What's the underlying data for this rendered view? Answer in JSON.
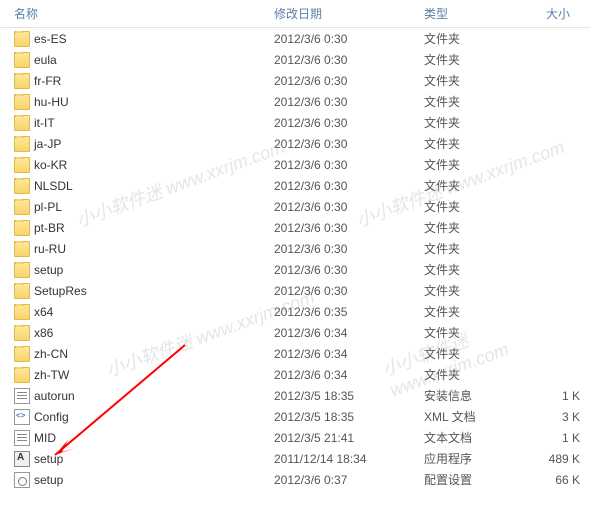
{
  "header": {
    "name": "名称",
    "date": "修改日期",
    "type": "类型",
    "size": "大小"
  },
  "iconTypes": {
    "folder": "folder-icon",
    "ini": "ini-icon",
    "xml": "xml-icon",
    "txt": "txt-icon",
    "exe": "exe-icon",
    "cfg": "cfg-icon"
  },
  "rows": [
    {
      "name": "es-ES",
      "date": "2012/3/6 0:30",
      "type": "文件夹",
      "size": "",
      "icon": "folder"
    },
    {
      "name": "eula",
      "date": "2012/3/6 0:30",
      "type": "文件夹",
      "size": "",
      "icon": "folder"
    },
    {
      "name": "fr-FR",
      "date": "2012/3/6 0:30",
      "type": "文件夹",
      "size": "",
      "icon": "folder"
    },
    {
      "name": "hu-HU",
      "date": "2012/3/6 0:30",
      "type": "文件夹",
      "size": "",
      "icon": "folder"
    },
    {
      "name": "it-IT",
      "date": "2012/3/6 0:30",
      "type": "文件夹",
      "size": "",
      "icon": "folder"
    },
    {
      "name": "ja-JP",
      "date": "2012/3/6 0:30",
      "type": "文件夹",
      "size": "",
      "icon": "folder"
    },
    {
      "name": "ko-KR",
      "date": "2012/3/6 0:30",
      "type": "文件夹",
      "size": "",
      "icon": "folder"
    },
    {
      "name": "NLSDL",
      "date": "2012/3/6 0:30",
      "type": "文件夹",
      "size": "",
      "icon": "folder"
    },
    {
      "name": "pl-PL",
      "date": "2012/3/6 0:30",
      "type": "文件夹",
      "size": "",
      "icon": "folder"
    },
    {
      "name": "pt-BR",
      "date": "2012/3/6 0:30",
      "type": "文件夹",
      "size": "",
      "icon": "folder"
    },
    {
      "name": "ru-RU",
      "date": "2012/3/6 0:30",
      "type": "文件夹",
      "size": "",
      "icon": "folder"
    },
    {
      "name": "setup",
      "date": "2012/3/6 0:30",
      "type": "文件夹",
      "size": "",
      "icon": "folder"
    },
    {
      "name": "SetupRes",
      "date": "2012/3/6 0:30",
      "type": "文件夹",
      "size": "",
      "icon": "folder"
    },
    {
      "name": "x64",
      "date": "2012/3/6 0:35",
      "type": "文件夹",
      "size": "",
      "icon": "folder"
    },
    {
      "name": "x86",
      "date": "2012/3/6 0:34",
      "type": "文件夹",
      "size": "",
      "icon": "folder"
    },
    {
      "name": "zh-CN",
      "date": "2012/3/6 0:34",
      "type": "文件夹",
      "size": "",
      "icon": "folder"
    },
    {
      "name": "zh-TW",
      "date": "2012/3/6 0:34",
      "type": "文件夹",
      "size": "",
      "icon": "folder"
    },
    {
      "name": "autorun",
      "date": "2012/3/5 18:35",
      "type": "安装信息",
      "size": "1 K",
      "icon": "ini"
    },
    {
      "name": "Config",
      "date": "2012/3/5 18:35",
      "type": "XML 文档",
      "size": "3 K",
      "icon": "xml"
    },
    {
      "name": "MID",
      "date": "2012/3/5 21:41",
      "type": "文本文档",
      "size": "1 K",
      "icon": "txt"
    },
    {
      "name": "setup",
      "date": "2011/12/14 18:34",
      "type": "应用程序",
      "size": "489 K",
      "icon": "exe"
    },
    {
      "name": "setup",
      "date": "2012/3/6 0:37",
      "type": "配置设置",
      "size": "66 K",
      "icon": "cfg"
    }
  ],
  "watermark": "小小软件迷 www.xxrjm.com"
}
